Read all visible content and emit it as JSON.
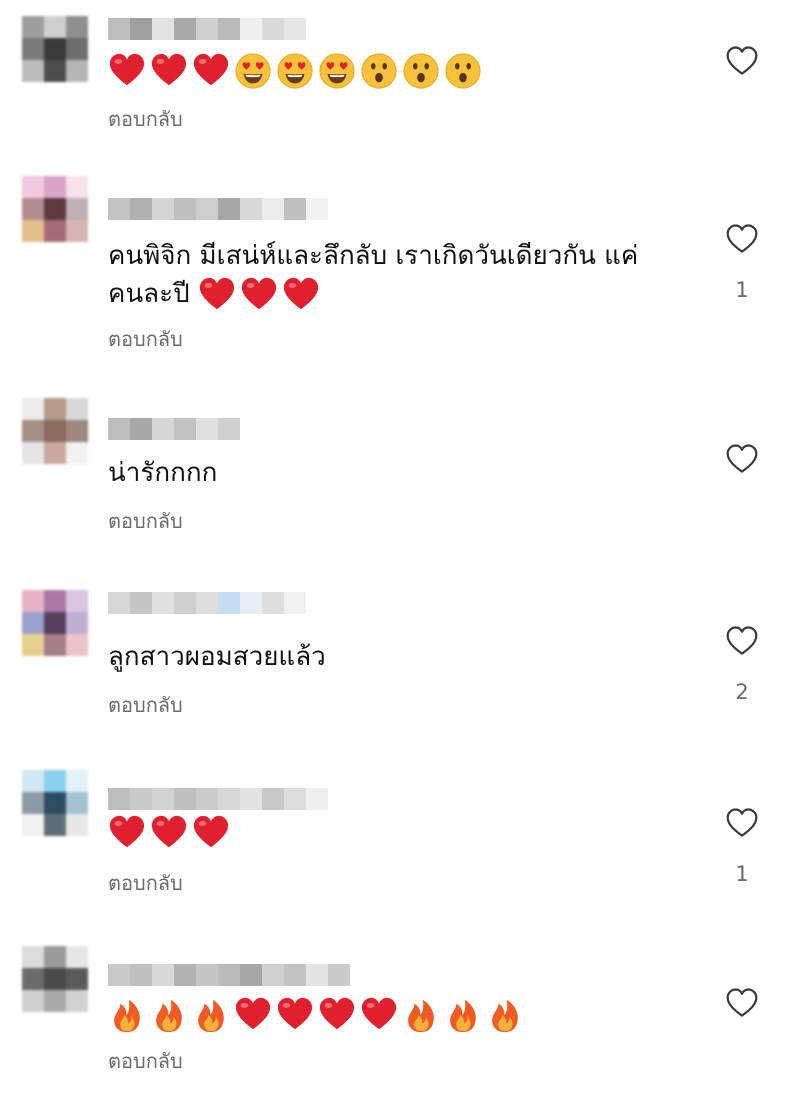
{
  "reply_label": "ตอบกลับ",
  "heart_icon": "heart-outline-icon",
  "colors": {
    "text": "#111111",
    "muted": "#6b6b6b",
    "heart": "#e0202e",
    "fire": "#f5801f"
  },
  "comments": [
    {
      "avatar": [
        "#9e9e9e",
        "#cfcfcf",
        "#8f8f8f",
        "#7a7a7a",
        "#3a3a3a",
        "#6d6d6d",
        "#bcbcbc",
        "#4d4d4d",
        "#b5b5b5"
      ],
      "username_blocks": [
        "#bdbdbd",
        "#9f9f9f",
        "#e3e3e3",
        "#a9a9a9",
        "#cfcfcf",
        "#bababa",
        "#efefef",
        "#dadada",
        "#e6e6e6"
      ],
      "text": "",
      "emojis": [
        "heart",
        "heart",
        "heart",
        "heart-eyes",
        "heart-eyes",
        "heart-eyes",
        "surprised",
        "surprised",
        "surprised"
      ],
      "like_count": ""
    },
    {
      "avatar": [
        "#f2c9dd",
        "#d8a5c6",
        "#f6e1ec",
        "#b28d8f",
        "#5b3b40",
        "#bdb0b7",
        "#e4c08a",
        "#a46c78",
        "#d7b7b4"
      ],
      "username_blocks": [
        "#c3c3c3",
        "#b0b0b0",
        "#d5d5d5",
        "#bebebe",
        "#cdcdcd",
        "#a7a7a7",
        "#d9d9d9",
        "#ececec",
        "#bfbfbf",
        "#f1f1f1"
      ],
      "text": "คนพิจิก มีเสน่ห์และลึกลับ เราเกิดวันเดียวกัน แค่",
      "text_line2": "คนละปี",
      "emojis_inline": [
        "heart",
        "heart",
        "heart"
      ],
      "like_count": "1"
    },
    {
      "avatar": [
        "#ececec",
        "#b59a8a",
        "#d8d8d8",
        "#a68d86",
        "#8a6b5f",
        "#9e8681",
        "#e5e5e5",
        "#caa7a0",
        "#f1f1f1"
      ],
      "username_blocks": [
        "#bdbdbd",
        "#a8a8a8",
        "#d6d6d6",
        "#c2c2c2",
        "#e0e0e0",
        "#cfcfcf"
      ],
      "text": "น่ารักกกก",
      "emojis": [],
      "like_count": ""
    },
    {
      "avatar": [
        "#e8b2c9",
        "#a979a6",
        "#d9c4e0",
        "#9aa2d0",
        "#57405d",
        "#c1aed3",
        "#e6d08d",
        "#a37f88",
        "#e9c3c8"
      ],
      "username_blocks": [
        "#d7d7d7",
        "#c6c6c6",
        "#e0e0e0",
        "#cfcfcf",
        "#dedede",
        "#c5dcf2",
        "#e7eef6",
        "#dedede",
        "#f0f0f0"
      ],
      "text": "ลูกสาวผอมสวยแล้ว",
      "emojis": [],
      "like_count": "2"
    },
    {
      "avatar": [
        "#cfe8f2",
        "#8ad0f0",
        "#e3f2f8",
        "#8c9aa3",
        "#2d4e61",
        "#a6c1cf",
        "#f1f1f1",
        "#5f6e76",
        "#e8e8e8"
      ],
      "username_blocks": [
        "#bdbdbd",
        "#cacaca",
        "#d3d3d3",
        "#c0c0c0",
        "#cbcbcb",
        "#d7d7d7",
        "#e2e2e2",
        "#c8c8c8",
        "#dcdcdc",
        "#efefef"
      ],
      "text": "",
      "emojis": [
        "heart",
        "heart",
        "heart"
      ],
      "like_count": "1"
    },
    {
      "avatar": [
        "#dcdcdc",
        "#9a9a9a",
        "#e6e6e6",
        "#6b6b6b",
        "#4a4a4a",
        "#5b5b5b",
        "#cfcfcf",
        "#a9a9a9",
        "#d2d2d2"
      ],
      "username_blocks": [
        "#c9c9c9",
        "#bebebe",
        "#d9d9d9",
        "#b2b2b2",
        "#c6c6c6",
        "#bbbbbb",
        "#a7a7a7",
        "#d0d0d0",
        "#c2c2c2",
        "#e4e4e4",
        "#cacaca"
      ],
      "text": "",
      "emojis": [
        "fire",
        "fire",
        "fire",
        "heart",
        "heart",
        "heart",
        "heart",
        "fire",
        "fire",
        "fire"
      ],
      "like_count": ""
    }
  ]
}
